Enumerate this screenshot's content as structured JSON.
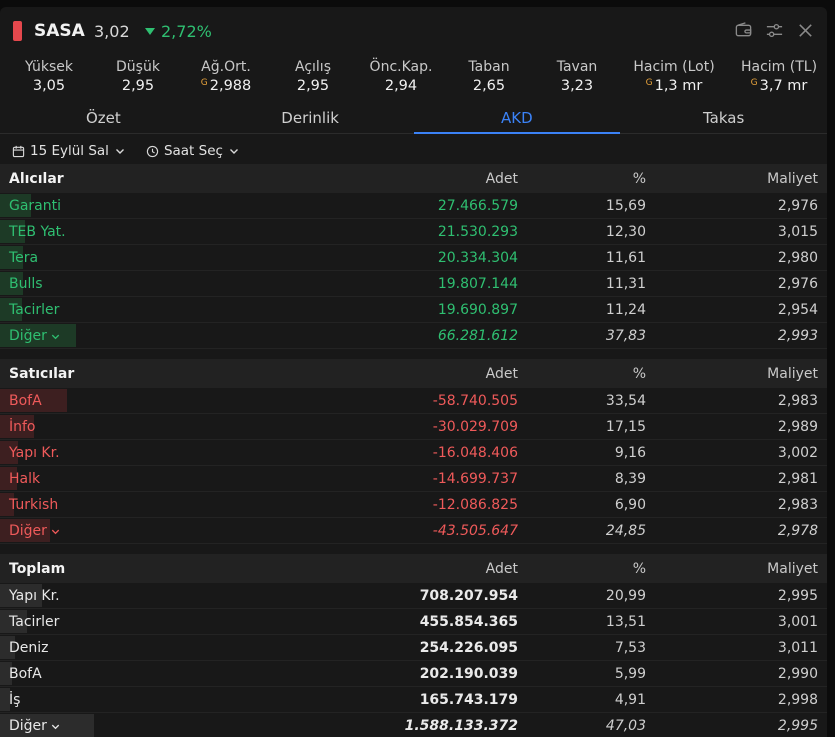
{
  "header": {
    "symbol": "SASA",
    "price": "3,02",
    "change": "2,72%"
  },
  "stats": [
    {
      "label": "Yüksek",
      "value": "3,05",
      "g": ""
    },
    {
      "label": "Düşük",
      "value": "2,95",
      "g": ""
    },
    {
      "label": "Ağ.Ort.",
      "value": "2,988",
      "g": "G"
    },
    {
      "label": "Açılış",
      "value": "2,95",
      "g": ""
    },
    {
      "label": "Önc.Kap.",
      "value": "2,94",
      "g": ""
    },
    {
      "label": "Taban",
      "value": "2,65",
      "g": ""
    },
    {
      "label": "Tavan",
      "value": "3,23",
      "g": ""
    },
    {
      "label": "Hacim (Lot)",
      "value": "1,3 mr",
      "g": "G"
    },
    {
      "label": "Hacim (TL)",
      "value": "3,7 mr",
      "g": "G"
    }
  ],
  "tabs": [
    "Özet",
    "Derinlik",
    "AKD",
    "Takas"
  ],
  "filters": {
    "date": "15 Eylül Sal",
    "time": "Saat Seç"
  },
  "columns": {
    "adet": "Adet",
    "pct": "%",
    "maliyet": "Maliyet"
  },
  "buyers": {
    "title": "Alıcılar",
    "rows": [
      {
        "name": "Garanti",
        "adet": "27.466.579",
        "pct": "15,69",
        "maliyet": "2,976",
        "share": 15.69
      },
      {
        "name": "TEB Yat.",
        "adet": "21.530.293",
        "pct": "12,30",
        "maliyet": "3,015",
        "share": 12.3
      },
      {
        "name": "Tera",
        "adet": "20.334.304",
        "pct": "11,61",
        "maliyet": "2,980",
        "share": 11.61
      },
      {
        "name": "Bulls",
        "adet": "19.807.144",
        "pct": "11,31",
        "maliyet": "2,976",
        "share": 11.31
      },
      {
        "name": "Tacirler",
        "adet": "19.690.897",
        "pct": "11,24",
        "maliyet": "2,954",
        "share": 11.24
      }
    ],
    "other": {
      "name": "Diğer",
      "adet": "66.281.612",
      "pct": "37,83",
      "maliyet": "2,993",
      "share": 37.83
    }
  },
  "sellers": {
    "title": "Satıcılar",
    "rows": [
      {
        "name": "BofA",
        "adet": "-58.740.505",
        "pct": "33,54",
        "maliyet": "2,983",
        "share": 33.54
      },
      {
        "name": "İnfo",
        "adet": "-30.029.709",
        "pct": "17,15",
        "maliyet": "2,989",
        "share": 17.15
      },
      {
        "name": "Yapı Kr.",
        "adet": "-16.048.406",
        "pct": "9,16",
        "maliyet": "3,002",
        "share": 9.16
      },
      {
        "name": "Halk",
        "adet": "-14.699.737",
        "pct": "8,39",
        "maliyet": "2,981",
        "share": 8.39
      },
      {
        "name": "Turkish",
        "adet": "-12.086.825",
        "pct": "6,90",
        "maliyet": "2,983",
        "share": 6.9
      }
    ],
    "other": {
      "name": "Diğer",
      "adet": "-43.505.647",
      "pct": "24,85",
      "maliyet": "2,978",
      "share": 24.85
    }
  },
  "totals": {
    "title": "Toplam",
    "rows": [
      {
        "name": "Yapı Kr.",
        "adet": "708.207.954",
        "pct": "20,99",
        "maliyet": "2,995",
        "share": 20.99
      },
      {
        "name": "Tacirler",
        "adet": "455.854.365",
        "pct": "13,51",
        "maliyet": "3,001",
        "share": 13.51
      },
      {
        "name": "Deniz",
        "adet": "254.226.095",
        "pct": "7,53",
        "maliyet": "3,011",
        "share": 7.53
      },
      {
        "name": "BofA",
        "adet": "202.190.039",
        "pct": "5,99",
        "maliyet": "2,990",
        "share": 5.99
      },
      {
        "name": "İş",
        "adet": "165.743.179",
        "pct": "4,91",
        "maliyet": "2,998",
        "share": 4.91
      }
    ],
    "other": {
      "name": "Diğer",
      "adet": "1.588.133.372",
      "pct": "47,03",
      "maliyet": "2,995",
      "share": 47.03
    }
  },
  "colors": {
    "green": "#2fbf71",
    "red": "#ef5a5a",
    "accent": "#3b82f6",
    "buyer_bar": "#1d3a26",
    "seller_bar": "#3d1f20",
    "total_bar": "#2c2c2c"
  }
}
